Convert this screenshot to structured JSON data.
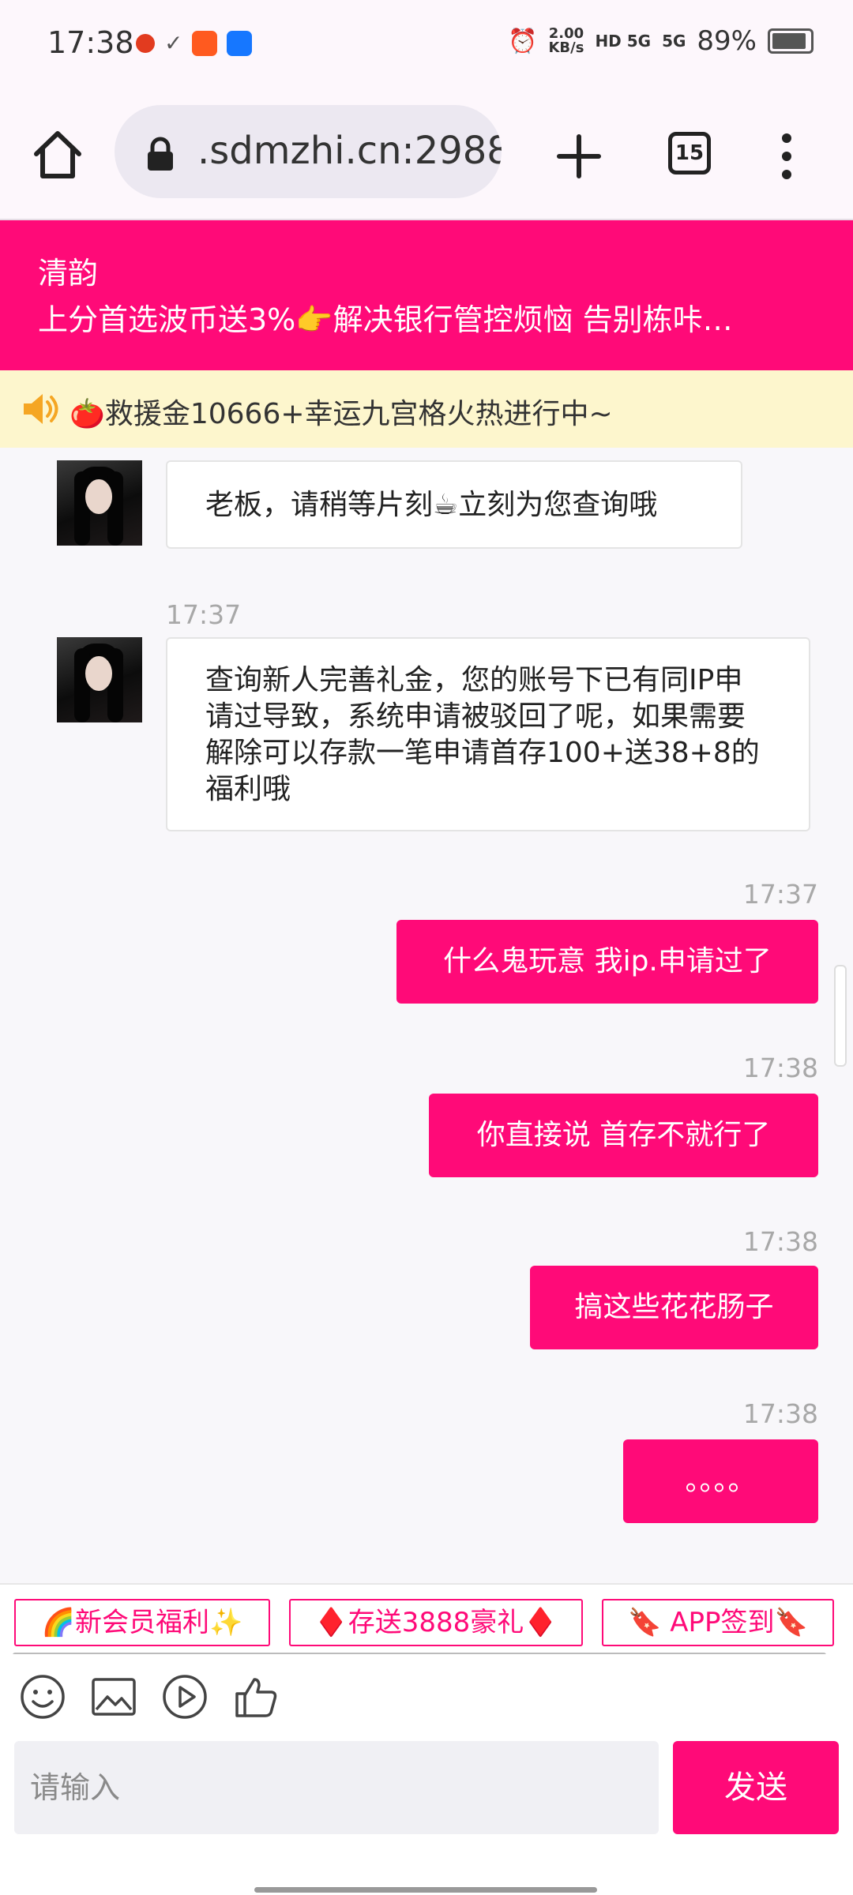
{
  "status_bar": {
    "time": "17:38",
    "net_speed_value": "2.00",
    "net_speed_unit": "KB/s",
    "signal_1": "HD 5G",
    "signal_2": "5G",
    "battery_percent": "89%",
    "battery_level": 0.89
  },
  "browser": {
    "url": ".sdmzhi.cn:2988",
    "tab_count": "15"
  },
  "chat_header": {
    "name": "清韵",
    "notice": "上分首选波币送3%👉解决银行管控烦恼 告别栋咔…"
  },
  "marquee": {
    "text": "🍅救援金10666+幸运九宫格火热进行中~"
  },
  "messages": [
    {
      "direction": "in",
      "time": "",
      "text": "老板，请稍等片刻☕立刻为您查询哦"
    },
    {
      "direction": "in",
      "time": "17:37",
      "text": "查询新人完善礼金，您的账号下已有同IP申请过导致，系统申请被驳回了呢，如果需要解除可以存款一笔申请首存100+送38+8的福利哦"
    },
    {
      "direction": "out",
      "time": "17:37",
      "text": "什么鬼玩意 我ip.申请过了"
    },
    {
      "direction": "out",
      "time": "17:38",
      "text": "你直接说 首存不就行了"
    },
    {
      "direction": "out",
      "time": "17:38",
      "text": "搞这些花花肠子"
    },
    {
      "direction": "out",
      "time": "17:38",
      "text": "。。。。"
    }
  ],
  "quick_buttons": [
    {
      "label": "🌈新会员福利✨"
    },
    {
      "label": "♦️存送3888豪礼♦️"
    },
    {
      "label": "🔖 APP签到🔖"
    }
  ],
  "tools": [
    "emoji-icon",
    "image-icon",
    "video-icon",
    "thumbs-up-icon"
  ],
  "input": {
    "placeholder": "请输入",
    "send_label": "发送"
  },
  "colors": {
    "brand": "#ff0a78",
    "marquee_bg": "#fdf6cd"
  }
}
